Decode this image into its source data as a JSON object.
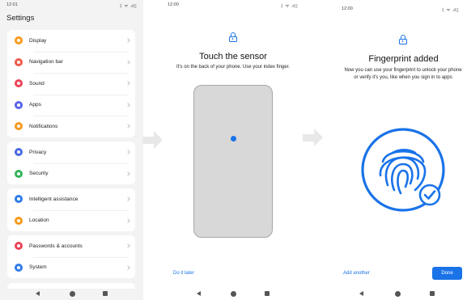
{
  "colors": {
    "accent": "#1a73e8",
    "settings_bg": "#f3f3f3",
    "sensor_gray": "#d8d8d8"
  },
  "status_bar": {
    "icons": "ᛒ ᯤ .ıl▯"
  },
  "settings": {
    "status_time": "12:01",
    "title": "Settings",
    "groups": [
      {
        "items": [
          {
            "label": "Display",
            "icon": "display-icon",
            "color": "#f59a1b"
          },
          {
            "label": "Navigation bar",
            "icon": "navigation-icon",
            "color": "#ef5a4a"
          },
          {
            "label": "Sound",
            "icon": "sound-icon",
            "color": "#ec4257"
          },
          {
            "label": "Apps",
            "icon": "apps-icon",
            "color": "#5b63e8"
          },
          {
            "label": "Notifications",
            "icon": "notifications-icon",
            "color": "#f59a1b"
          }
        ]
      },
      {
        "items": [
          {
            "label": "Privacy",
            "icon": "privacy-icon",
            "color": "#4769e0"
          },
          {
            "label": "Security",
            "icon": "security-icon",
            "color": "#34b45a"
          }
        ]
      },
      {
        "items": [
          {
            "label": "Intelligent assistance",
            "icon": "assistant-icon",
            "color": "#2d7be8"
          },
          {
            "label": "Location",
            "icon": "location-icon",
            "color": "#f59a1b"
          }
        ]
      },
      {
        "items": [
          {
            "label": "Passwords & accounts",
            "icon": "key-icon",
            "color": "#ec4257"
          },
          {
            "label": "System",
            "icon": "system-icon",
            "color": "#2d7be8"
          }
        ]
      }
    ]
  },
  "touch_sensor": {
    "status_time": "12:00",
    "title": "Touch the sensor",
    "description": "It's on the back of your phone. Use your index finger.",
    "skip_label": "Do it later"
  },
  "fingerprint_added": {
    "status_time": "12:00",
    "title": "Fingerprint added",
    "description": "Now you can use your fingerprint to unlock your phone or verify it's you, like when you sign in to apps",
    "add_another_label": "Add another",
    "done_label": "Done"
  }
}
